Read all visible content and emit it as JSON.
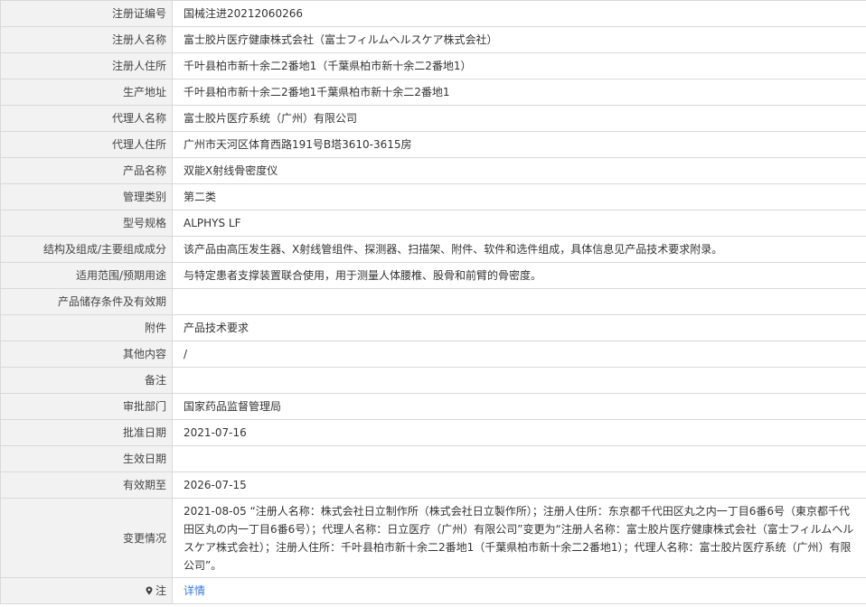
{
  "rows": [
    {
      "label": "注册证编号",
      "value": "国械注进20212060266"
    },
    {
      "label": "注册人名称",
      "value": "富士胶片医疗健康株式会社（富士フィルムヘルスケア株式会社）"
    },
    {
      "label": "注册人住所",
      "value": "千叶县柏市新十余二2番地1（千葉県柏市新十余二2番地1）"
    },
    {
      "label": "生产地址",
      "value": "千叶县柏市新十余二2番地1千葉県柏市新十余二2番地1"
    },
    {
      "label": "代理人名称",
      "value": "富士胶片医疗系统（广州）有限公司"
    },
    {
      "label": "代理人住所",
      "value": "广州市天河区体育西路191号B塔3610-3615房"
    },
    {
      "label": "产品名称",
      "value": "双能X射线骨密度仪"
    },
    {
      "label": "管理类别",
      "value": "第二类"
    },
    {
      "label": "型号规格",
      "value": "ALPHYS LF"
    },
    {
      "label": "结构及组成/主要组成成分",
      "value": "该产品由高压发生器、X射线管组件、探测器、扫描架、附件、软件和选件组成，具体信息见产品技术要求附录。"
    },
    {
      "label": "适用范围/预期用途",
      "value": "与特定患者支撑装置联合使用，用于测量人体腰椎、股骨和前臂的骨密度。"
    },
    {
      "label": "产品储存条件及有效期",
      "value": ""
    },
    {
      "label": "附件",
      "value": "产品技术要求"
    },
    {
      "label": "其他内容",
      "value": "/"
    },
    {
      "label": "备注",
      "value": ""
    },
    {
      "label": "审批部门",
      "value": "国家药品监督管理局"
    },
    {
      "label": "批准日期",
      "value": "2021-07-16"
    },
    {
      "label": "生效日期",
      "value": ""
    },
    {
      "label": "有效期至",
      "value": "2026-07-15"
    },
    {
      "label": "变更情况",
      "value": "2021-08-05 “注册人名称：株式会社日立制作所（株式会社日立製作所）；注册人住所：东京都千代田区丸之内一丁目6番6号（東京都千代田区丸の内一丁目6番6号）；代理人名称：日立医疗（广州）有限公司”变更为“注册人名称：富士胶片医疗健康株式会社（富士フィルムヘルスケア株式会社）；注册人住所：千叶县柏市新十余二2番地1（千葉県柏市新十余二2番地1）；代理人名称：富士胶片医疗系统（广州）有限公司”。"
    }
  ],
  "note": {
    "label": "注",
    "icon": "pin-icon",
    "link_text": "详情",
    "link_color": "#3a7bd5"
  }
}
